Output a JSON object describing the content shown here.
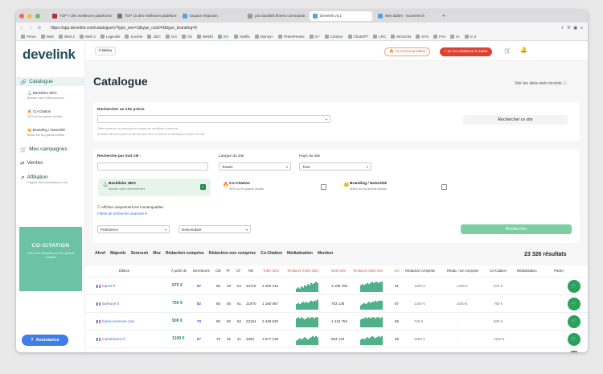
{
  "browser": {
    "tabs": [
      {
        "label": "TOP 7 des meilleures plateforme…",
        "color": "#b03030"
      },
      {
        "label": "TOP 10 des meilleures plateforme…",
        "color": "#777"
      },
      {
        "label": "Espace rédaction",
        "color": "#5aa0e0"
      },
      {
        "label": "prix backlink fitness commande…",
        "color": "#999"
      },
      {
        "label": "Develink v3.1",
        "color": "#5aa0e0"
      },
      {
        "label": "Mes tables - Scometre.fr",
        "color": "#5aa0e0"
      }
    ],
    "new_tab": "+",
    "url": "https://app.develink.com/catalogue/v?type_seo=1&type_cocit=0&type_branding=0",
    "bookmarks": [
      "Perso",
      "Web",
      "Web 2",
      "Web 3",
      "Logiciels",
      "Societe",
      "JdrC",
      "Grv",
      "Gk",
      "Webfd",
      "IG+",
      "Netflix",
      "Disney+",
      "PressPresse",
      "G+",
      "Contexr",
      "ChatGPT",
      "LRC",
      "MAISON",
      "SYS",
      "FAV",
      "IA",
      "IA 2"
    ]
  },
  "sidebar": {
    "logo": "develink",
    "items": [
      {
        "label": "Catalogue",
        "icon": "link-icon"
      },
      {
        "label": "Mes campagnes",
        "icon": "cart-icon"
      },
      {
        "label": "Ventes",
        "icon": "swap-icon"
      },
      {
        "label": "Affiliation",
        "icon": "trend-icon"
      }
    ],
    "sub": [
      {
        "label": "Backlinks SEO",
        "desc": "Booster votre référencement"
      },
      {
        "label": "Co-Citation",
        "desc": "40% sur les grands médias"
      },
      {
        "label": "Branding / Notoriété",
        "desc": "Brillez sur les grands médias"
      }
    ],
    "affiliation_desc": "Gagnez des commissions à vie",
    "ad_title": "CO-CITATION",
    "ad_text": "Citez vos marques sur les grands médias",
    "assist": "Assistance"
  },
  "topbar": {
    "menu": "Menu",
    "immo": "21 Immanquables",
    "cocitations": "12 Co-Citations à Saisir"
  },
  "page": {
    "title": "Catalogue",
    "recent": "Voir les sites web récents"
  },
  "search": {
    "site_label": "Rechercher un site précis",
    "site_help1": "Cette recherche ne prend pas en compte les conditions ci-dessous",
    "site_help2": "Si aucun site trouvé avec le site web pour être sûr d'avoir un résultat plus précis et le site",
    "site_button": "Rechercher ce site",
    "kw_label": "Recherche par mot clé :",
    "lang_label": "Langue du site",
    "lang_value": "Toutes",
    "country_label": "Pays du site",
    "country_value": "Tous"
  },
  "options": [
    {
      "title": "Backlinks SEO",
      "desc": "Booster votre référencement",
      "icon": "⚓",
      "checked": true
    },
    {
      "title": "Co-Citation",
      "desc": "40% sur les grands médias",
      "icon": "🔥",
      "checked": false
    },
    {
      "title": "Branding / Notoriété",
      "desc": "Brillez sur les grands médias",
      "icon": "👑",
      "checked": false
    }
  ],
  "filters": {
    "immanquables": "Afficher uniquement les immanquables",
    "advanced": "Filtres de recherche avancée",
    "sort_by": "Pertinence",
    "order": "Descendant",
    "search_btn": "Rechercher"
  },
  "result_tabs": [
    "Ahref",
    "Majestic",
    "Semrush",
    "Moz",
    "Rédaction comprise",
    "Rédaction non comprise",
    "Co-Citation",
    "Médiatisation",
    "Mention"
  ],
  "results_count": "23 326 résultats",
  "table": {
    "headers": [
      "Éditeur",
      "À partir de",
      "Develscore",
      "CM",
      "TF",
      "CF",
      "RD",
      "Trafic SEO",
      "Tendance Trafic SEO",
      "Mots-clés",
      "Tendance Mots-clés",
      "DA",
      "Rédaction comprise",
      "Rédac. non comprise",
      "Co-Citation",
      "Médiatisation",
      "Panier"
    ],
    "rows": [
      {
        "site": "topsnt.fr",
        "price": "975 €",
        "score": "87",
        "cm": "86",
        "tf": "48",
        "cf": "64",
        "rd": "34719",
        "traffic": "3 250 416",
        "kw": "2 199 706",
        "da": "91",
        "redac": "1500 €",
        "nonredac": "1400 €",
        "cocit": "975 €",
        "spark1": [
          3,
          4,
          3,
          5,
          4,
          6,
          5,
          7,
          6,
          8,
          7,
          8,
          9,
          8
        ],
        "spark2": [
          6,
          7,
          6,
          7,
          8,
          7,
          8,
          9,
          8,
          9,
          9,
          8,
          9,
          9
        ]
      },
      {
        "site": "lanfeune.fr",
        "price": "750 €",
        "score": "82",
        "cm": "85",
        "tf": "56",
        "cf": "61",
        "rd": "21870",
        "traffic": "1 160 087",
        "kw": "703 136",
        "da": "87",
        "redac": "1200 €",
        "nonredac": "1050 €",
        "cocit": "750 €",
        "spark1": [
          5,
          6,
          5,
          6,
          7,
          6,
          7,
          6,
          7,
          8,
          7,
          8,
          8,
          9
        ],
        "spark2": [
          4,
          5,
          6,
          5,
          6,
          7,
          6,
          7,
          7,
          8,
          7,
          8,
          8,
          8
        ]
      },
      {
        "site": "future-sciences.com",
        "price": "500 €",
        "score": "73",
        "cm": "85",
        "tf": "60",
        "cf": "52",
        "rd": "23154",
        "traffic": "2 448 628",
        "kw": "1 418 753",
        "da": "89",
        "redac": "720 €",
        "nonredac": "-",
        "cocit": "500 €",
        "spark1": [
          8,
          9,
          8,
          9,
          8,
          7,
          8,
          9,
          8,
          9,
          9,
          8,
          9,
          9
        ],
        "spark2": [
          7,
          8,
          8,
          9,
          8,
          9,
          8,
          9,
          9,
          8,
          9,
          9,
          8,
          9
        ]
      },
      {
        "site": "marieframce.fr",
        "price": "1100 €",
        "score": "67",
        "cm": "76",
        "tf": "25",
        "cf": "41",
        "rd": "3363",
        "traffic": "1 677 139",
        "kw": "584 133",
        "da": "68",
        "redac": "1550 €",
        "nonredac": "-",
        "cocit": "1100 €",
        "spark1": [
          4,
          5,
          6,
          5,
          6,
          7,
          6,
          5,
          6,
          7,
          8,
          7,
          8,
          7
        ],
        "spark2": [
          5,
          6,
          5,
          6,
          7,
          6,
          7,
          8,
          7,
          6,
          7,
          8,
          7,
          8
        ]
      },
      {
        "site": "tourmonde-aventframce.fr",
        "price": "550 €",
        "score": "45",
        "cm": "90",
        "tf": "23",
        "cf": "37",
        "rd": "497",
        "traffic": "39 012 724",
        "kw": "8 242 743",
        "da": "93",
        "redac": "900 €",
        "nonredac": "900 €",
        "cocit": "550 €",
        "spark1": [
          6,
          7,
          8,
          7,
          8,
          9,
          8,
          9,
          8,
          9,
          9,
          8,
          9,
          9
        ],
        "spark2": [
          7,
          8,
          7,
          8,
          9,
          8,
          9,
          9,
          8,
          9,
          9,
          9,
          9,
          9
        ]
      }
    ]
  },
  "colors": {
    "accent": "#1f8a4c",
    "brand": "#1f4f5c",
    "danger": "#e0412f",
    "ad": "#6bc2a4"
  }
}
